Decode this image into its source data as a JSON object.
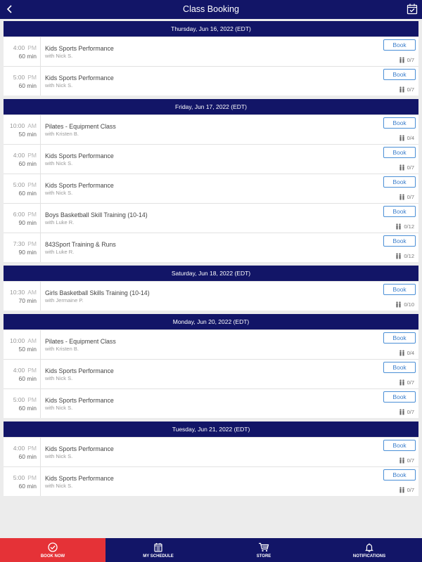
{
  "header": {
    "title": "Class Booking"
  },
  "book_label": "Book",
  "days": [
    {
      "date": "Thursday, Jun 16, 2022 (EDT)",
      "classes": [
        {
          "time": "4:00",
          "ampm": "PM",
          "duration": "60 min",
          "name": "Kids Sports Performance",
          "instructor": "with Nick S.",
          "capacity": "0/7"
        },
        {
          "time": "5:00",
          "ampm": "PM",
          "duration": "60 min",
          "name": "Kids Sports Performance",
          "instructor": "with Nick S.",
          "capacity": "0/7"
        }
      ]
    },
    {
      "date": "Friday, Jun 17, 2022 (EDT)",
      "classes": [
        {
          "time": "10:00",
          "ampm": "AM",
          "duration": "50 min",
          "name": "Pilates - Equipment Class",
          "instructor": "with Kristen B.",
          "capacity": "0/4"
        },
        {
          "time": "4:00",
          "ampm": "PM",
          "duration": "60 min",
          "name": "Kids Sports Performance",
          "instructor": "with Nick S.",
          "capacity": "0/7"
        },
        {
          "time": "5:00",
          "ampm": "PM",
          "duration": "60 min",
          "name": "Kids Sports Performance",
          "instructor": "with Nick S.",
          "capacity": "0/7"
        },
        {
          "time": "6:00",
          "ampm": "PM",
          "duration": "90 min",
          "name": "Boys Basketball Skill Training (10-14)",
          "instructor": "with Luke R.",
          "capacity": "0/12"
        },
        {
          "time": "7:30",
          "ampm": "PM",
          "duration": "90 min",
          "name": "843Sport Training & Runs",
          "instructor": "with Luke R.",
          "capacity": "0/12"
        }
      ]
    },
    {
      "date": "Saturday, Jun 18, 2022 (EDT)",
      "classes": [
        {
          "time": "10:30",
          "ampm": "AM",
          "duration": "70 min",
          "name": "Girls Basketball Skills Training (10-14)",
          "instructor": "with Jermaine P.",
          "capacity": "0/10"
        }
      ]
    },
    {
      "date": "Monday, Jun 20, 2022 (EDT)",
      "classes": [
        {
          "time": "10:00",
          "ampm": "AM",
          "duration": "50 min",
          "name": "Pilates - Equipment Class",
          "instructor": "with Kristen B.",
          "capacity": "0/4"
        },
        {
          "time": "4:00",
          "ampm": "PM",
          "duration": "60 min",
          "name": "Kids Sports Performance",
          "instructor": "with Nick S.",
          "capacity": "0/7"
        },
        {
          "time": "5:00",
          "ampm": "PM",
          "duration": "60 min",
          "name": "Kids Sports Performance",
          "instructor": "with Nick S.",
          "capacity": "0/7"
        }
      ]
    },
    {
      "date": "Tuesday, Jun 21, 2022 (EDT)",
      "classes": [
        {
          "time": "4:00",
          "ampm": "PM",
          "duration": "60 min",
          "name": "Kids Sports Performance",
          "instructor": "with Nick S.",
          "capacity": "0/7"
        },
        {
          "time": "5:00",
          "ampm": "PM",
          "duration": "60 min",
          "name": "Kids Sports Performance",
          "instructor": "with Nick S.",
          "capacity": "0/7"
        }
      ]
    }
  ],
  "bottom_nav": [
    {
      "label": "BOOK NOW",
      "icon": "check-circle-icon",
      "active": true
    },
    {
      "label": "MY SCHEDULE",
      "icon": "schedule-icon",
      "active": false
    },
    {
      "label": "STORE",
      "icon": "cart-icon",
      "active": false
    },
    {
      "label": "NOTIFICATIONS",
      "icon": "bell-icon",
      "active": false
    }
  ],
  "colors": {
    "primary": "#121567",
    "accent": "#e53237",
    "button": "#3c7fcc",
    "background": "#ececec"
  }
}
